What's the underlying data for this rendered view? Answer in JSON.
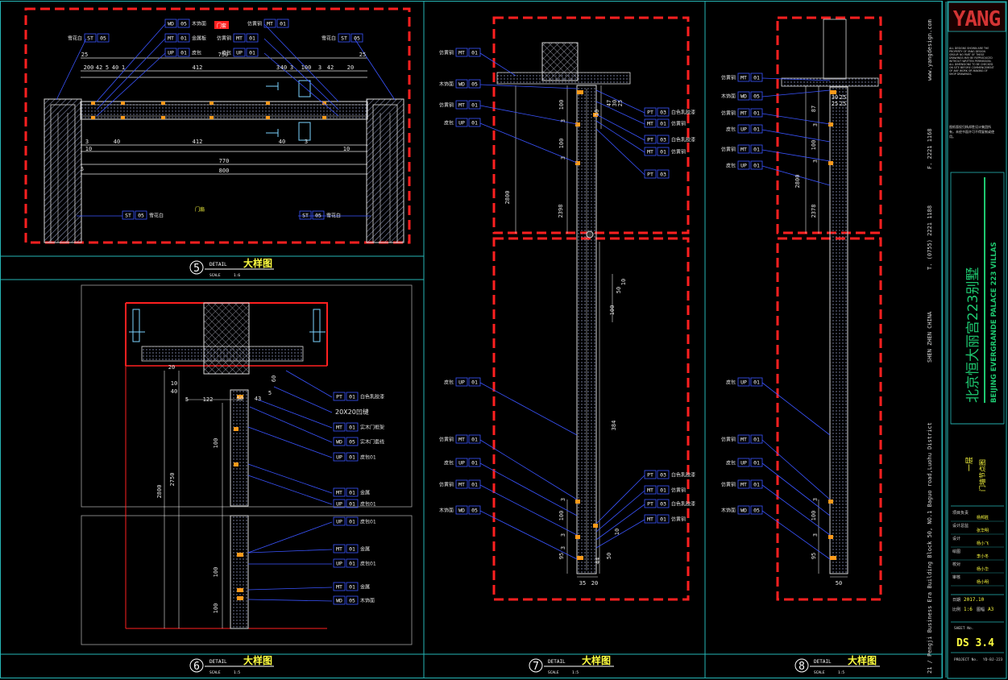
{
  "colors": {
    "background": "#000000",
    "frame": "#26b6b6",
    "boundary": "#ff2020",
    "panel": "#d8d8d8",
    "dimension": "#e6e6e6",
    "callout": "#3a54ff",
    "hatch": "#9aa2c8",
    "fitting": "#ff9a1a",
    "title": "#ffff40",
    "logo": "#d43434",
    "accent": "#1ec870"
  },
  "details": [
    {
      "number": "5",
      "label": "DETAIL",
      "title": "大样图",
      "scale_label": "SCALE",
      "scale": "1:6"
    },
    {
      "number": "6",
      "label": "DETAIL",
      "title": "大样图",
      "scale_label": "SCALE",
      "scale": "1:5"
    },
    {
      "number": "7",
      "label": "DETAIL",
      "title": "大样图",
      "scale_label": "SCALE",
      "scale": "1:5"
    },
    {
      "number": "8",
      "label": "DETAIL",
      "title": "大样图",
      "scale_label": "SCALE",
      "scale": "1:5"
    }
  ],
  "d5": {
    "dims_top": [
      "25",
      "200",
      "42",
      "5",
      "40",
      "1",
      "412",
      "750",
      "3",
      "40",
      "3",
      "100",
      "3",
      "42",
      "20",
      "25"
    ],
    "dims_bottom": [
      "3",
      "10",
      "40",
      "412",
      "40",
      "3",
      "10",
      "5",
      "770",
      "800"
    ],
    "callouts_left": [
      {
        "tag": "ST",
        "code": "05",
        "note": "雪花白"
      },
      {
        "tag": "WD",
        "code": "05",
        "note": "木饰面"
      },
      {
        "tag": "MT",
        "code": "01",
        "note": "金属板"
      },
      {
        "tag": "UP",
        "code": "01",
        "note": "皮包"
      }
    ],
    "callouts_right": [
      {
        "tag": "MT",
        "code": "01",
        "note": "仿黄铜"
      },
      {
        "tag": "MT",
        "code": "01",
        "note": "仿黄铜"
      },
      {
        "tag": "UP",
        "code": "01",
        "note": "皮包"
      },
      {
        "tag": "ST",
        "code": "05",
        "note": "雪花白"
      }
    ],
    "bottom_callouts": [
      {
        "tag": "ST",
        "code": "05",
        "note": "雪花白"
      },
      {
        "tag": "ST",
        "code": "05",
        "note": "雪花白"
      }
    ],
    "note_red": "门套",
    "note_center": "门扇"
  },
  "d6": {
    "dims": [
      "20",
      "10",
      "40",
      "5",
      "122",
      "50",
      "43",
      "5",
      "60",
      "100",
      "2750",
      "2800",
      "100",
      "100"
    ],
    "callouts": [
      {
        "tag": "PT",
        "code": "01",
        "note": "白色乳胶漆"
      },
      {
        "tag": "",
        "code": "",
        "note": "20X20凹缝"
      },
      {
        "tag": "MT",
        "code": "01",
        "note": "实木门框架"
      },
      {
        "tag": "WD",
        "code": "05",
        "note": "实木门套线"
      },
      {
        "tag": "UP",
        "code": "01",
        "note": "皮包01"
      },
      {
        "tag": "MT",
        "code": "01",
        "note": "金属"
      },
      {
        "tag": "UP",
        "code": "01",
        "note": "皮包01"
      },
      {
        "tag": "UP",
        "code": "01",
        "note": "皮包01"
      },
      {
        "tag": "MT",
        "code": "01",
        "note": "金属"
      },
      {
        "tag": "UP",
        "code": "01",
        "note": "皮包01"
      },
      {
        "tag": "MT",
        "code": "01",
        "note": "金属"
      },
      {
        "tag": "WD",
        "code": "05",
        "note": "木饰面"
      }
    ]
  },
  "d7": {
    "dims": [
      "35",
      "20",
      "100",
      "3",
      "100",
      "3",
      "2800",
      "2398",
      "10",
      "47",
      "30",
      "25",
      "100",
      "50",
      "10",
      "3",
      "384",
      "3",
      "100",
      "3",
      "95",
      "44",
      "50",
      "10"
    ],
    "callouts_left": [
      {
        "tag": "MT",
        "code": "01",
        "note": "仿黄铜"
      },
      {
        "tag": "WD",
        "code": "05",
        "note": "木饰面"
      },
      {
        "tag": "MT",
        "code": "01",
        "note": "仿黄铜"
      },
      {
        "tag": "UP",
        "code": "01",
        "note": "皮包"
      },
      {
        "tag": "UP",
        "code": "01",
        "note": "皮包"
      },
      {
        "tag": "MT",
        "code": "01",
        "note": "仿黄铜"
      },
      {
        "tag": "UP",
        "code": "01",
        "note": "皮包"
      },
      {
        "tag": "MT",
        "code": "01",
        "note": "仿黄铜"
      },
      {
        "tag": "WD",
        "code": "05",
        "note": "木饰面"
      }
    ],
    "callouts_right": [
      {
        "tag": "PT",
        "code": "03",
        "note": "白色乳胶漆"
      },
      {
        "tag": "MT",
        "code": "01",
        "note": "仿黄铜"
      },
      {
        "tag": "PT",
        "code": "03",
        "note": "白色乳胶漆"
      },
      {
        "tag": "MT",
        "code": "01",
        "note": "仿黄铜"
      },
      {
        "tag": "PT",
        "code": "03",
        "note": ""
      },
      {
        "tag": "PT",
        "code": "03",
        "note": "白色乳胶漆"
      },
      {
        "tag": "MT",
        "code": "01",
        "note": "仿黄铜"
      },
      {
        "tag": "PT",
        "code": "03",
        "note": "白色乳胶漆"
      },
      {
        "tag": "MT",
        "code": "01",
        "note": "仿黄铜"
      }
    ]
  },
  "d8": {
    "dims": [
      "30",
      "25",
      "25",
      "25",
      "87",
      "3",
      "100",
      "3",
      "2800",
      "2378",
      "3",
      "100",
      "3",
      "95",
      "50"
    ],
    "callouts": [
      {
        "tag": "MT",
        "code": "01",
        "note": "仿黄铜"
      },
      {
        "tag": "WD",
        "code": "05",
        "note": "木饰面"
      },
      {
        "tag": "MT",
        "code": "01",
        "note": "仿黄铜"
      },
      {
        "tag": "UP",
        "code": "01",
        "note": "皮包"
      },
      {
        "tag": "MT",
        "code": "01",
        "note": "仿黄铜"
      },
      {
        "tag": "UP",
        "code": "01",
        "note": "皮包"
      },
      {
        "tag": "UP",
        "code": "01",
        "note": "皮包"
      },
      {
        "tag": "MT",
        "code": "01",
        "note": "仿黄铜"
      },
      {
        "tag": "UP",
        "code": "01",
        "note": "皮包"
      },
      {
        "tag": "MT",
        "code": "01",
        "note": "仿黄铜"
      },
      {
        "tag": "WD",
        "code": "05",
        "note": "木饰面"
      }
    ]
  },
  "side_strip": {
    "address": "21 / Pengji Business Era Building Block 50, NO.1 Baguo road,Luohu District",
    "city": "SHEN ZHEN CHINA",
    "tel": "T. (0755) 2221 1188",
    "fax": "F. 2221 1168",
    "web": "www.yangdesign.com"
  },
  "title_block": {
    "logo": "YANG",
    "copyright": "ALL DESIGNS SHOWN ARE THE PROPERTY OF YANG DESIGN GROUP. NO PART OF THESE DRAWINGS MAY BE REPRODUCED WITHOUT WRITTEN PERMISSION. ALL DIMENSIONS TO BE CHECKED ON SITE BEFORE COMMENCEMENT OF ANY WORK OR MAKING OF SHOP DRAWINGS.",
    "copyright_cn": "图纸版权归杨邦胜设计集团所有，未经书面许可不得复制或使用。",
    "project_cn": "北京恒大丽宫223别墅",
    "project_en": "BEIJING EVERGRANDE PALACE 223 VILLAS",
    "floor": "一层",
    "sheet_title": "门墙节点图",
    "meta_rows": [
      {
        "label": "项目负责",
        "value": "杨邦胜"
      },
      {
        "label": "设计总监",
        "value": "张华明"
      },
      {
        "label": "设计",
        "value": "杨小飞"
      },
      {
        "label": "绘图",
        "value": "李小冬"
      },
      {
        "label": "校对",
        "value": "杨小华"
      },
      {
        "label": "审核",
        "value": "杨小明"
      }
    ],
    "date_label": "日期",
    "date": "2017.10",
    "scale_label": "比例",
    "scale": "1:6",
    "size_label": "图幅",
    "size": "A3",
    "sheet_no_label": "SHEET No.",
    "sheet_no": "DS 3.4",
    "project_no_label": "PROJECT No.",
    "project_no": "YD-BJ-223"
  }
}
